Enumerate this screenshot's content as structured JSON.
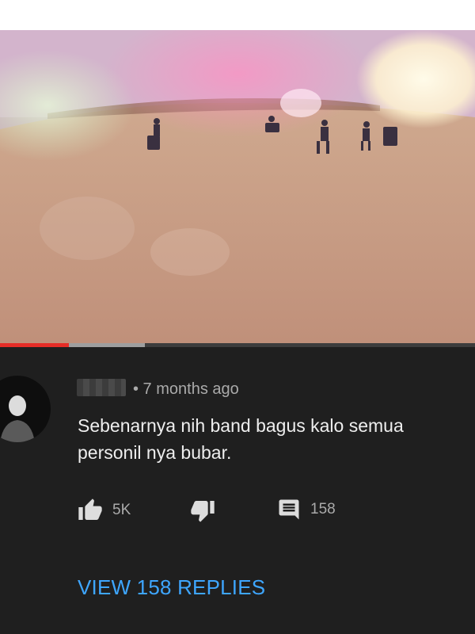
{
  "video": {
    "progress_played": 0.145,
    "progress_buffered": 0.305
  },
  "comment": {
    "timestamp": "• 7 months ago",
    "text_line1": "Sebenarnya nih band bagus kalo semua",
    "text_line2": "personil nya bubar.",
    "likes": "5K",
    "replies_count": "158",
    "view_replies": "VIEW 158 REPLIES"
  },
  "icons": {
    "like": "thumbs-up-icon",
    "dislike": "thumbs-down-icon",
    "reply": "comment-icon"
  },
  "colors": {
    "panel_bg": "#1f1f1f",
    "link": "#3ea6ff",
    "progress": "#e52d27"
  }
}
